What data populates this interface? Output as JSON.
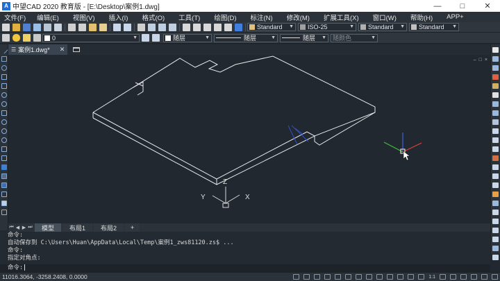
{
  "window": {
    "title": "中望CAD 2020 教育版 - [E:\\Desktop\\案例1.dwg]",
    "app_icon_letter": "A"
  },
  "menu": {
    "items": [
      "文件(F)",
      "编辑(E)",
      "视图(V)",
      "插入(I)",
      "格式(O)",
      "工具(T)",
      "绘图(D)",
      "标注(N)",
      "修改(M)",
      "扩展工具(X)",
      "窗口(W)",
      "帮助(H)",
      "APP+"
    ]
  },
  "toolbar1": {
    "text_style": "Standard",
    "dim_style": "ISO-25",
    "table_style": "Standard",
    "multileader_style": "Standard"
  },
  "toolbar2": {
    "layer_value": "0",
    "color_value": "随层",
    "linetype_value": "随层",
    "lineweight_value": "随层",
    "plotstyle_value": "随颜色"
  },
  "document": {
    "tab_label": "案例1.dwg*"
  },
  "ucs": {
    "x_label": "X",
    "y_label": "Y",
    "z_label": "Z"
  },
  "canvas_controls": [
    "–",
    "□",
    "×"
  ],
  "layout_tabs": {
    "model": "模型",
    "layout1": "布局1",
    "layout2": "布局2",
    "add": "+"
  },
  "command": {
    "history": [
      "命令:",
      "自动保存到 C:\\Users\\Huan\\AppData\\Local\\Temp\\案例1_zws81120.zs$ ...",
      "命令:",
      "指定对角点:"
    ],
    "prompt": "命令:"
  },
  "status": {
    "coordinates": "11016.3064, -3258.2408, 0.0000",
    "scale": "1:1"
  },
  "colors": {
    "canvas_bg": "#212830",
    "chrome_bg": "#2b323a",
    "accent": "#1f6fd6",
    "drawing_lines": "#e8e8e8",
    "axis_x": "#e04040",
    "axis_y": "#40c040",
    "axis_z": "#4060e0"
  }
}
